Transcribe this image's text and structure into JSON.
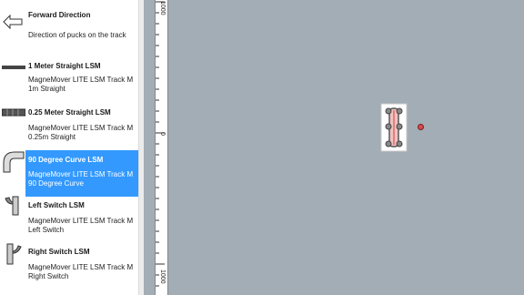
{
  "palette": {
    "items": [
      {
        "title": "Forward Direction",
        "desc": "Direction of pucks on the track",
        "icon": "arrow-left-icon"
      },
      {
        "title": "1 Meter Straight LSM",
        "desc": "MagneMover LITE LSM Track M\n1m Straight",
        "icon": "straight-track-icon"
      },
      {
        "title": "0.25 Meter Straight LSM",
        "desc": "MagneMover LITE LSM Track M\n0.25m Straight",
        "icon": "short-track-icon"
      },
      {
        "title": "90 Degree Curve LSM",
        "desc": "MagneMover LITE LSM Track M\n90 Degree Curve",
        "icon": "curve-track-icon"
      },
      {
        "title": "Left Switch LSM",
        "desc": "MagneMover LITE LSM Track M\nLeft Switch",
        "icon": "left-switch-icon"
      },
      {
        "title": "Right Switch LSM",
        "desc": "MagneMover LITE LSM Track M\nRight Switch",
        "icon": "right-switch-icon"
      }
    ]
  },
  "ruler": {
    "labels": [
      "1000",
      "0",
      "1000"
    ]
  },
  "colors": {
    "canvas": "#a2adb5",
    "selection": "#3399ff",
    "puck": "#d94a4a"
  }
}
